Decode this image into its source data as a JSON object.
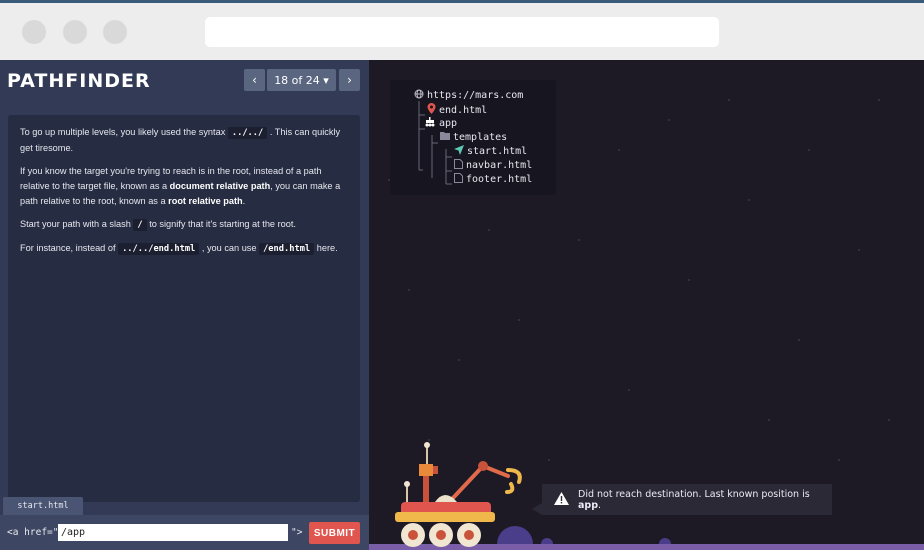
{
  "app": {
    "logo": "PATHFINDER"
  },
  "nav": {
    "prev": "‹",
    "page": "18 of 24 ▾",
    "next": "›"
  },
  "lesson": {
    "p1_before": "To go up multiple levels, you likely used the syntax",
    "p1_code": "../../",
    "p1_after": ". This can quickly get tiresome.",
    "p2_a": "If you know the target you're trying to reach is in the root, instead of a path relative to the target file, known as a",
    "p2_b": "document relative path",
    "p2_c": ", you can make a path relative to the root, known as a",
    "p2_d": "root relative path",
    "p2_e": ".",
    "p3_a": "Start your path with a slash",
    "p3_code": "/",
    "p3_b": "to signify that it's starting at the root.",
    "p4_a": "For instance, instead of",
    "p4_code1": "../../end.html",
    "p4_b": ", you can use",
    "p4_code2": "/end.html",
    "p4_c": "here."
  },
  "editor": {
    "file_tab": "start.html",
    "prefix": "<a href=\"",
    "value": "/app",
    "suffix": "\">",
    "submit": "SUBMIT"
  },
  "tree": {
    "root": "https://mars.com",
    "items": [
      {
        "label": "end.html",
        "icon": "map-pin-icon"
      },
      {
        "label": "app",
        "icon": "rover-icon"
      },
      {
        "label": "templates",
        "icon": "folder-icon"
      },
      {
        "label": "start.html",
        "icon": "navigation-arrow-icon"
      },
      {
        "label": "navbar.html",
        "icon": "file-icon"
      },
      {
        "label": "footer.html",
        "icon": "file-icon"
      }
    ]
  },
  "toast": {
    "message": "Did not reach destination. Last known position is",
    "position": "app",
    "end": "."
  },
  "colors": {
    "accent": "#e0564e",
    "panel": "#323a56",
    "space": "#1d1a26"
  }
}
